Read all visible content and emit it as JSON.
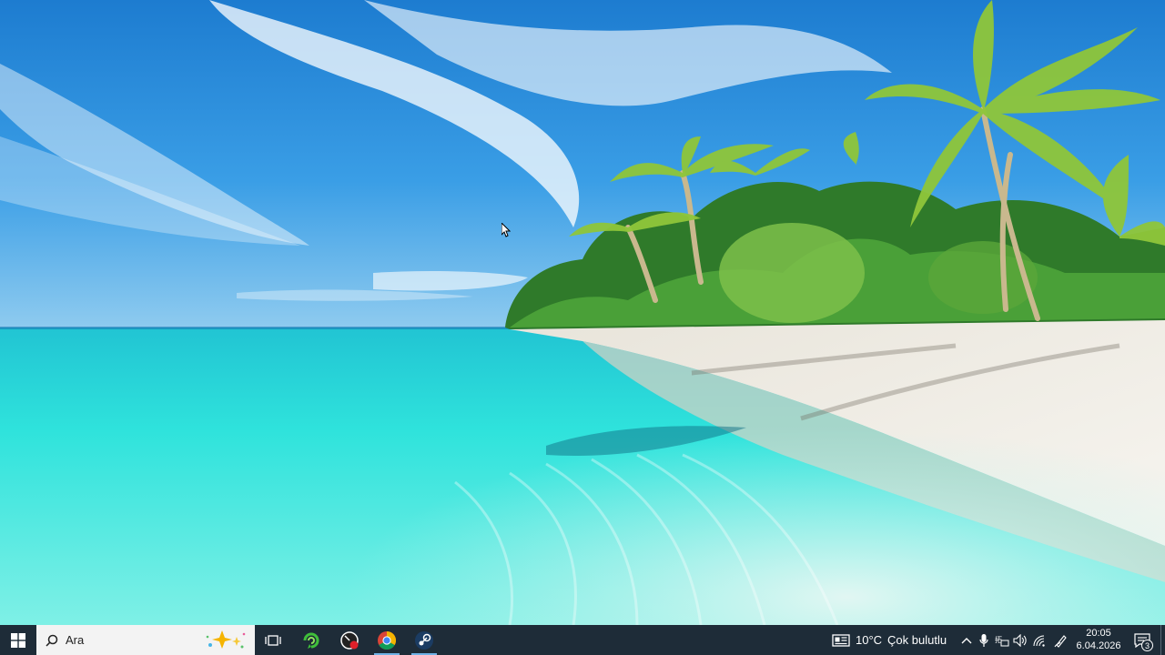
{
  "desktop": {
    "wallpaper": "tropical-beach-wallpaper"
  },
  "taskbar": {
    "start_icon": "windows-logo-icon",
    "search": {
      "placeholder": "Ara",
      "icon": "search-icon",
      "highlight_icon": "sparkle-highlight-icon"
    },
    "task_view_icon": "task-view-icon",
    "apps": [
      {
        "name": "green-swirl-app-icon",
        "running": false
      },
      {
        "name": "speedometer-app-icon",
        "running": false
      },
      {
        "name": "chrome-icon",
        "running": true
      },
      {
        "name": "steam-icon",
        "running": true
      }
    ],
    "weather": {
      "icon": "weather-widget-icon",
      "temperature": "10°C",
      "condition": "Çok bulutlu"
    },
    "tray": [
      "chevron-up-icon",
      "microphone-icon",
      "keyboard-language-icon",
      "volume-icon",
      "network-icon",
      "pen-icon"
    ],
    "clock": {
      "time": "20:05",
      "date": "6.04.2026"
    },
    "notifications": {
      "count": "3",
      "icon": "notification-center-icon"
    }
  },
  "colors": {
    "taskbar_bg": "#1e2c38",
    "search_bg": "#f3f3f3",
    "running_indicator": "#6fb2e6",
    "sky": "#2f8fd8",
    "water": "#2fe0d8",
    "sand": "#f1ede4"
  }
}
